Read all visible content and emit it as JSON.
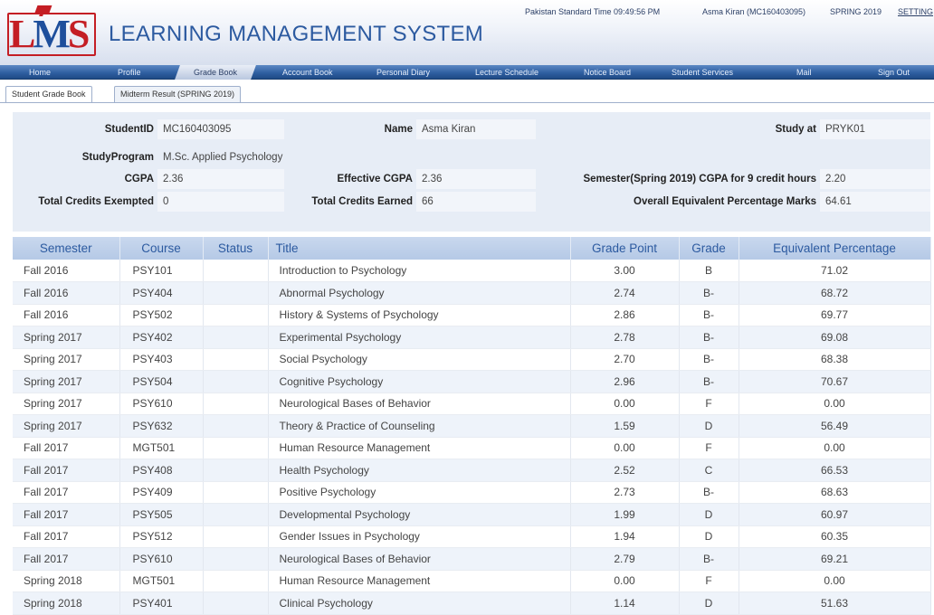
{
  "header": {
    "logo": {
      "l": "L",
      "m": "M",
      "s": "S"
    },
    "title": "LEARNING MANAGEMENT SYSTEM",
    "time": "Pakistan Standard Time 09:49:56 PM",
    "user": "Asma Kiran (MC160403095)",
    "semester": "SPRING 2019",
    "settings": "SETTING"
  },
  "nav": [
    "Home",
    "Profile",
    "Grade Book",
    "Account Book",
    "Personal Diary",
    "Lecture Schedule",
    "Notice Board",
    "Student Services",
    "Mail",
    "Sign Out"
  ],
  "tabs": [
    "Student Grade Book",
    "Midterm Result (SPRING 2019)"
  ],
  "student": {
    "id_label": "StudentID",
    "id": "MC160403095",
    "name_label": "Name",
    "name": "Asma Kiran",
    "study_label": "Study at",
    "study": "PRYK01",
    "program_label": "StudyProgram",
    "program": "M.Sc. Applied Psychology",
    "cgpa_label": "CGPA",
    "cgpa": "2.36",
    "ecgpa_label": "Effective CGPA",
    "ecgpa": "2.36",
    "sem_cgpa_label": "Semester(Spring 2019) CGPA for 9 credit hours",
    "sem_cgpa": "2.20",
    "exempt_label": "Total Credits Exempted",
    "exempt": "0",
    "earned_label": "Total Credits Earned",
    "earned": "66",
    "pct_label": "Overall Equivalent Percentage Marks",
    "pct": "64.61"
  },
  "table": {
    "headers": [
      "Semester",
      "Course",
      "Status",
      "Title",
      "Grade Point",
      "Grade",
      "Equivalent Percentage"
    ],
    "rows": [
      [
        "Fall 2016",
        "PSY101",
        "",
        "Introduction to Psychology",
        "3.00",
        "B",
        "71.02"
      ],
      [
        "Fall 2016",
        "PSY404",
        "",
        "Abnormal Psychology",
        "2.74",
        "B-",
        "68.72"
      ],
      [
        "Fall 2016",
        "PSY502",
        "",
        "History & Systems of Psychology",
        "2.86",
        "B-",
        "69.77"
      ],
      [
        "Spring 2017",
        "PSY402",
        "",
        "Experimental Psychology",
        "2.78",
        "B-",
        "69.08"
      ],
      [
        "Spring 2017",
        "PSY403",
        "",
        "Social Psychology",
        "2.70",
        "B-",
        "68.38"
      ],
      [
        "Spring 2017",
        "PSY504",
        "",
        "Cognitive Psychology",
        "2.96",
        "B-",
        "70.67"
      ],
      [
        "Spring 2017",
        "PSY610",
        "",
        "Neurological Bases of Behavior",
        "0.00",
        "F",
        "0.00"
      ],
      [
        "Spring 2017",
        "PSY632",
        "",
        "Theory & Practice of Counseling",
        "1.59",
        "D",
        "56.49"
      ],
      [
        "Fall 2017",
        "MGT501",
        "",
        "Human Resource Management",
        "0.00",
        "F",
        "0.00"
      ],
      [
        "Fall 2017",
        "PSY408",
        "",
        "Health Psychology",
        "2.52",
        "C",
        "66.53"
      ],
      [
        "Fall 2017",
        "PSY409",
        "",
        "Positive Psychology",
        "2.73",
        "B-",
        "68.63"
      ],
      [
        "Fall 2017",
        "PSY505",
        "",
        "Developmental Psychology",
        "1.99",
        "D",
        "60.97"
      ],
      [
        "Fall 2017",
        "PSY512",
        "",
        "Gender Issues in Psychology",
        "1.94",
        "D",
        "60.35"
      ],
      [
        "Fall 2017",
        "PSY610",
        "",
        "Neurological Bases of Behavior",
        "2.79",
        "B-",
        "69.21"
      ],
      [
        "Spring 2018",
        "MGT501",
        "",
        "Human Resource Management",
        "0.00",
        "F",
        "0.00"
      ],
      [
        "Spring 2018",
        "PSY401",
        "",
        "Clinical Psychology",
        "1.14",
        "D",
        "51.63"
      ]
    ]
  }
}
